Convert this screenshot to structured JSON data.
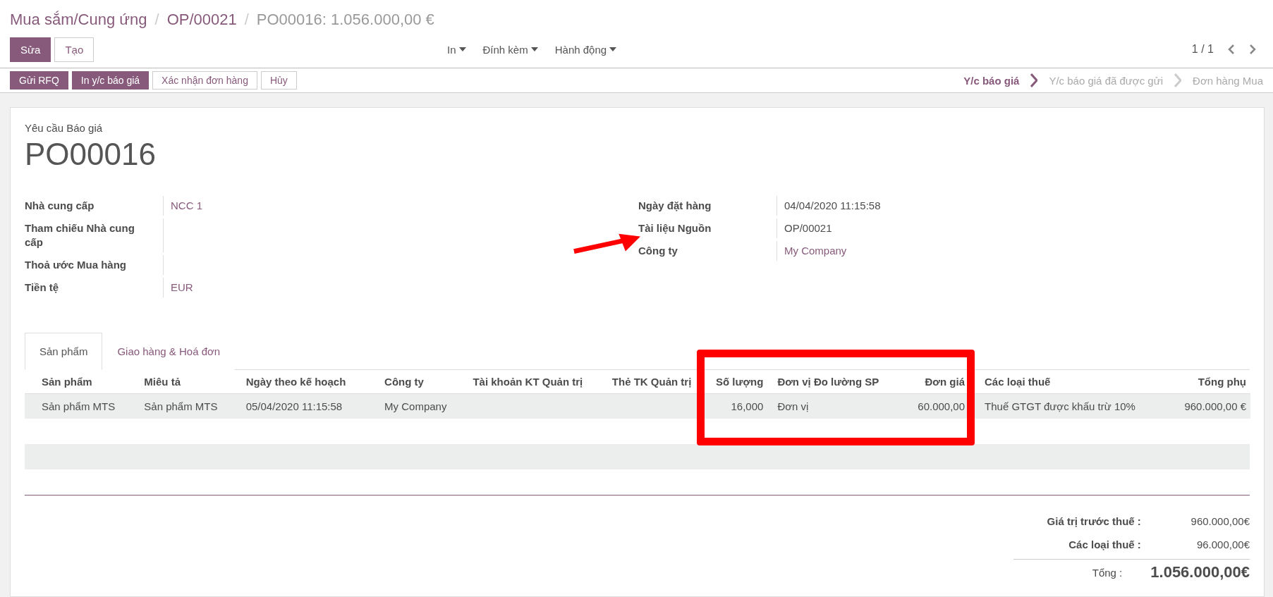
{
  "breadcrumbs": [
    {
      "label": "Mua sắm/Cung ứng",
      "link": true
    },
    {
      "label": "OP/00021",
      "link": true
    },
    {
      "label": "PO00016: 1.056.000,00 €",
      "link": false
    }
  ],
  "breadcrumb_separators": [
    "/",
    "/"
  ],
  "main_buttons": [
    {
      "label": "Sửa",
      "primary": true
    },
    {
      "label": "Tạo",
      "primary": false
    }
  ],
  "menus": [
    "In",
    "Đính kèm",
    "Hành động"
  ],
  "pager": "1 / 1",
  "action_buttons": [
    {
      "label": "Gửi RFQ",
      "primary": true
    },
    {
      "label": "In y/c báo giá",
      "primary": true
    },
    {
      "label": "Xác nhận đơn hàng",
      "primary": false
    },
    {
      "label": "Hủy",
      "primary": false
    }
  ],
  "stages": [
    {
      "label": "Y/c báo giá",
      "selected": true
    },
    {
      "label": "Y/c báo giá đã được gửi",
      "selected": false
    },
    {
      "label": "Đơn hàng Mua",
      "selected": false
    }
  ],
  "form": {
    "subtitle": "Yêu cầu Báo giá",
    "name": "PO00016",
    "left_fields": [
      {
        "label": "Nhà cung cấp",
        "value": "NCC 1",
        "link": true
      },
      {
        "label": "Tham chiếu Nhà cung cấp"
      },
      {
        "label": "Thoả ước Mua hàng"
      },
      {
        "label": "Tiền tệ",
        "value": "EUR",
        "link": true
      }
    ],
    "right_fields": [
      {
        "label": "Ngày đặt hàng",
        "value": "04/04/2020 11:15:58",
        "link": false
      },
      {
        "label": "Tài liệu Nguồn",
        "value": "OP/00021",
        "link": false
      },
      {
        "label": "Công ty",
        "value": "My Company",
        "link": true
      }
    ]
  },
  "tabs": [
    {
      "label": "Sản phẩm",
      "selected": true
    },
    {
      "label": "Giao hàng & Hoá đơn",
      "selected": false
    }
  ],
  "table": {
    "columns": [
      {
        "label": "Sản phẩm",
        "kind": "text"
      },
      {
        "label": "Miêu tả",
        "kind": "text"
      },
      {
        "label": "Ngày theo kế hoạch",
        "kind": "text"
      },
      {
        "label": "Công ty",
        "kind": "text"
      },
      {
        "label": "Tài khoản KT Quản trị",
        "kind": "text"
      },
      {
        "label": "Thẻ TK Quản trị",
        "kind": "text"
      },
      {
        "label": "Số lượng",
        "kind": "number"
      },
      {
        "label": "Đơn vị Đo lường SP",
        "kind": "text"
      },
      {
        "label": "Đơn giá",
        "kind": "number"
      },
      {
        "label": "Các loại thuế",
        "kind": "text"
      },
      {
        "label": "Tổng phụ",
        "kind": "number"
      }
    ],
    "rows": [
      [
        "Sản phẩm MTS",
        "Sản phẩm MTS",
        "05/04/2020 11:15:58",
        "My Company",
        null,
        null,
        "16,000",
        "Đơn vị",
        "60.000,00",
        "Thuế GTGT được khấu trừ 10%",
        "960.000,00 €"
      ]
    ]
  },
  "totals": [
    {
      "label": "Giá trị trước thuế :",
      "value": "960.000,00€",
      "kind": "line"
    },
    {
      "label": "Các loại thuế :",
      "value": "96.000,00€",
      "kind": "line"
    },
    {
      "label": "Tổng :",
      "value": "1.056.000,00€",
      "kind": "grand"
    }
  ]
}
